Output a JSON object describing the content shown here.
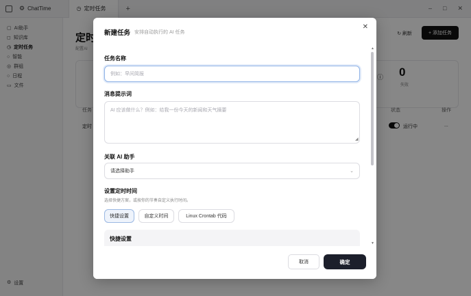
{
  "app": {
    "name": "ChatTime",
    "tab_label": "定时任务",
    "sidebar": [
      {
        "label": "AI助手"
      },
      {
        "label": "知识库"
      },
      {
        "label": "定时任务"
      },
      {
        "label": "智能"
      },
      {
        "label": "群组"
      },
      {
        "label": "日程"
      },
      {
        "label": "文件"
      }
    ],
    "sidebar_settings": "设置",
    "page_title": "定时",
    "page_subtitle": "配置AI",
    "refresh_label": "刷新",
    "add_task_label": "添加任务",
    "stat_value": "0",
    "stat_label": "失败",
    "col_task": "任务",
    "col_status": "状态",
    "col_action": "操作",
    "row_task": "定时",
    "row_status": "运行中",
    "row_action": "..."
  },
  "modal": {
    "title": "新建任务",
    "subtitle": "安排自动执行的 AI 任务",
    "task_name_label": "任务名称",
    "task_name_placeholder": "例如：早间简报",
    "prompt_label": "消息提示词",
    "prompt_placeholder": "AI 应该做什么？例如：给我一份今天的新闻和天气摘要",
    "assistant_label": "关联 AI 助手",
    "assistant_value": "请选择助手",
    "schedule_label": "设置定时时间",
    "schedule_helper": "选择快捷方案，或按你的节奏自定义执行时间。",
    "schedule_modes": [
      {
        "label": "快捷设置",
        "active": true
      },
      {
        "label": "自定义时间",
        "active": false
      },
      {
        "label": "Linux Crontab 代码",
        "active": false
      }
    ],
    "quick_panel_title": "快捷设置",
    "cancel_label": "取消",
    "confirm_label": "确定"
  },
  "colors": {
    "overlay": "#000000",
    "primary_button": "#1c1f2b",
    "focus_ring": "#8fb2e6",
    "active_segment_bg": "#eef3fb"
  }
}
